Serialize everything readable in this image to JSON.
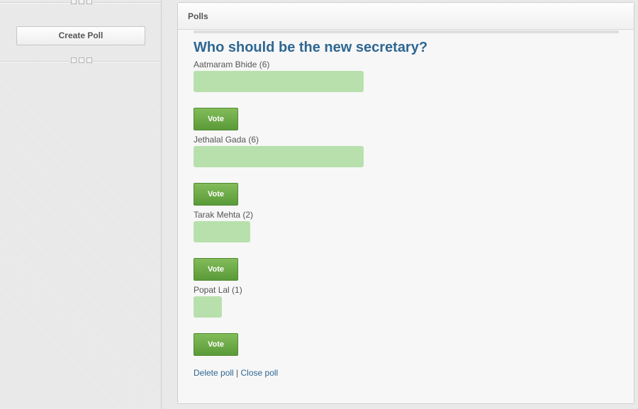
{
  "sidebar": {
    "create_poll_label": "Create Poll"
  },
  "panel": {
    "title": "Polls"
  },
  "poll": {
    "question": "Who should be the new secretary?",
    "options": [
      {
        "label": "Aatmaram Bhide (6)",
        "votes": 6,
        "vote_label": "Vote"
      },
      {
        "label": "Jethalal Gada (6)",
        "votes": 6,
        "vote_label": "Vote"
      },
      {
        "label": "Tarak Mehta (2)",
        "votes": 2,
        "vote_label": "Vote"
      },
      {
        "label": "Popat Lal (1)",
        "votes": 1,
        "vote_label": "Vote"
      }
    ],
    "links": {
      "delete_label": "Delete poll",
      "separator": "|",
      "close_label": "Close poll"
    }
  },
  "colors": {
    "bar_fill": "#b8e0ad",
    "vote_button": "#6aa845",
    "title": "#2e6792"
  }
}
